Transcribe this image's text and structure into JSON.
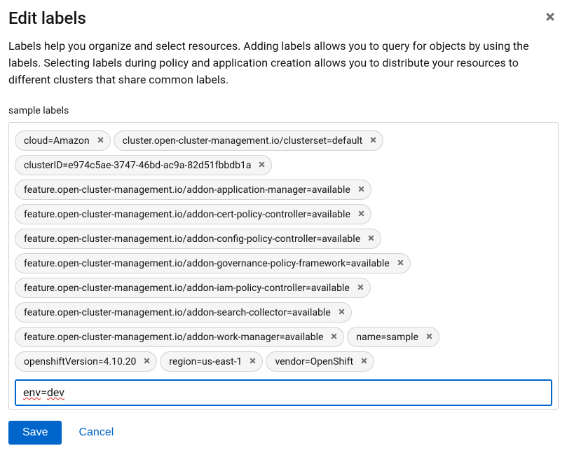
{
  "dialog": {
    "title": "Edit labels",
    "description": "Labels help you organize and select resources. Adding labels allows you to query for objects by using the labels. Selecting labels during policy and application creation allows you to distribute your resources to different clusters that share common labels.",
    "field_label": "sample labels",
    "input_value": "env=dev",
    "save_label": "Save",
    "cancel_label": "Cancel"
  },
  "labels": [
    "cloud=Amazon",
    "cluster.open-cluster-management.io/clusterset=default",
    "clusterID=e974c5ae-3747-46bd-ac9a-82d51fbbdb1a",
    "feature.open-cluster-management.io/addon-application-manager=available",
    "feature.open-cluster-management.io/addon-cert-policy-controller=available",
    "feature.open-cluster-management.io/addon-config-policy-controller=available",
    "feature.open-cluster-management.io/addon-governance-policy-framework=available",
    "feature.open-cluster-management.io/addon-iam-policy-controller=available",
    "feature.open-cluster-management.io/addon-search-collector=available",
    "feature.open-cluster-management.io/addon-work-manager=available",
    "name=sample",
    "openshiftVersion=4.10.20",
    "region=us-east-1",
    "vendor=OpenShift"
  ]
}
